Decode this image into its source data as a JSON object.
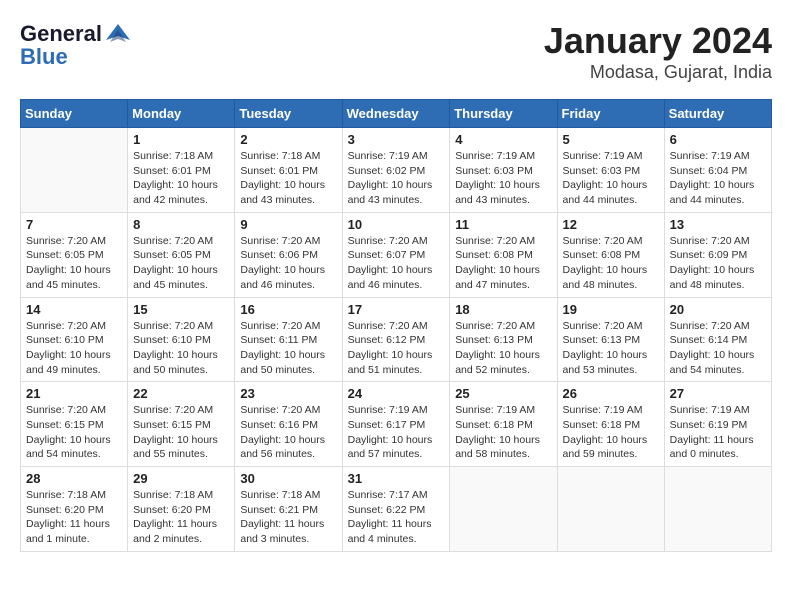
{
  "header": {
    "logo_line1": "General",
    "logo_line2": "Blue",
    "title": "January 2024",
    "subtitle": "Modasa, Gujarat, India"
  },
  "days_of_week": [
    "Sunday",
    "Monday",
    "Tuesday",
    "Wednesday",
    "Thursday",
    "Friday",
    "Saturday"
  ],
  "weeks": [
    [
      {
        "date": "",
        "info": ""
      },
      {
        "date": "1",
        "info": "Sunrise: 7:18 AM\nSunset: 6:01 PM\nDaylight: 10 hours\nand 42 minutes."
      },
      {
        "date": "2",
        "info": "Sunrise: 7:18 AM\nSunset: 6:01 PM\nDaylight: 10 hours\nand 43 minutes."
      },
      {
        "date": "3",
        "info": "Sunrise: 7:19 AM\nSunset: 6:02 PM\nDaylight: 10 hours\nand 43 minutes."
      },
      {
        "date": "4",
        "info": "Sunrise: 7:19 AM\nSunset: 6:03 PM\nDaylight: 10 hours\nand 43 minutes."
      },
      {
        "date": "5",
        "info": "Sunrise: 7:19 AM\nSunset: 6:03 PM\nDaylight: 10 hours\nand 44 minutes."
      },
      {
        "date": "6",
        "info": "Sunrise: 7:19 AM\nSunset: 6:04 PM\nDaylight: 10 hours\nand 44 minutes."
      }
    ],
    [
      {
        "date": "7",
        "info": "Sunrise: 7:20 AM\nSunset: 6:05 PM\nDaylight: 10 hours\nand 45 minutes."
      },
      {
        "date": "8",
        "info": "Sunrise: 7:20 AM\nSunset: 6:05 PM\nDaylight: 10 hours\nand 45 minutes."
      },
      {
        "date": "9",
        "info": "Sunrise: 7:20 AM\nSunset: 6:06 PM\nDaylight: 10 hours\nand 46 minutes."
      },
      {
        "date": "10",
        "info": "Sunrise: 7:20 AM\nSunset: 6:07 PM\nDaylight: 10 hours\nand 46 minutes."
      },
      {
        "date": "11",
        "info": "Sunrise: 7:20 AM\nSunset: 6:08 PM\nDaylight: 10 hours\nand 47 minutes."
      },
      {
        "date": "12",
        "info": "Sunrise: 7:20 AM\nSunset: 6:08 PM\nDaylight: 10 hours\nand 48 minutes."
      },
      {
        "date": "13",
        "info": "Sunrise: 7:20 AM\nSunset: 6:09 PM\nDaylight: 10 hours\nand 48 minutes."
      }
    ],
    [
      {
        "date": "14",
        "info": "Sunrise: 7:20 AM\nSunset: 6:10 PM\nDaylight: 10 hours\nand 49 minutes."
      },
      {
        "date": "15",
        "info": "Sunrise: 7:20 AM\nSunset: 6:10 PM\nDaylight: 10 hours\nand 50 minutes."
      },
      {
        "date": "16",
        "info": "Sunrise: 7:20 AM\nSunset: 6:11 PM\nDaylight: 10 hours\nand 50 minutes."
      },
      {
        "date": "17",
        "info": "Sunrise: 7:20 AM\nSunset: 6:12 PM\nDaylight: 10 hours\nand 51 minutes."
      },
      {
        "date": "18",
        "info": "Sunrise: 7:20 AM\nSunset: 6:13 PM\nDaylight: 10 hours\nand 52 minutes."
      },
      {
        "date": "19",
        "info": "Sunrise: 7:20 AM\nSunset: 6:13 PM\nDaylight: 10 hours\nand 53 minutes."
      },
      {
        "date": "20",
        "info": "Sunrise: 7:20 AM\nSunset: 6:14 PM\nDaylight: 10 hours\nand 54 minutes."
      }
    ],
    [
      {
        "date": "21",
        "info": "Sunrise: 7:20 AM\nSunset: 6:15 PM\nDaylight: 10 hours\nand 54 minutes."
      },
      {
        "date": "22",
        "info": "Sunrise: 7:20 AM\nSunset: 6:15 PM\nDaylight: 10 hours\nand 55 minutes."
      },
      {
        "date": "23",
        "info": "Sunrise: 7:20 AM\nSunset: 6:16 PM\nDaylight: 10 hours\nand 56 minutes."
      },
      {
        "date": "24",
        "info": "Sunrise: 7:19 AM\nSunset: 6:17 PM\nDaylight: 10 hours\nand 57 minutes."
      },
      {
        "date": "25",
        "info": "Sunrise: 7:19 AM\nSunset: 6:18 PM\nDaylight: 10 hours\nand 58 minutes."
      },
      {
        "date": "26",
        "info": "Sunrise: 7:19 AM\nSunset: 6:18 PM\nDaylight: 10 hours\nand 59 minutes."
      },
      {
        "date": "27",
        "info": "Sunrise: 7:19 AM\nSunset: 6:19 PM\nDaylight: 11 hours\nand 0 minutes."
      }
    ],
    [
      {
        "date": "28",
        "info": "Sunrise: 7:18 AM\nSunset: 6:20 PM\nDaylight: 11 hours\nand 1 minute."
      },
      {
        "date": "29",
        "info": "Sunrise: 7:18 AM\nSunset: 6:20 PM\nDaylight: 11 hours\nand 2 minutes."
      },
      {
        "date": "30",
        "info": "Sunrise: 7:18 AM\nSunset: 6:21 PM\nDaylight: 11 hours\nand 3 minutes."
      },
      {
        "date": "31",
        "info": "Sunrise: 7:17 AM\nSunset: 6:22 PM\nDaylight: 11 hours\nand 4 minutes."
      },
      {
        "date": "",
        "info": ""
      },
      {
        "date": "",
        "info": ""
      },
      {
        "date": "",
        "info": ""
      }
    ]
  ]
}
